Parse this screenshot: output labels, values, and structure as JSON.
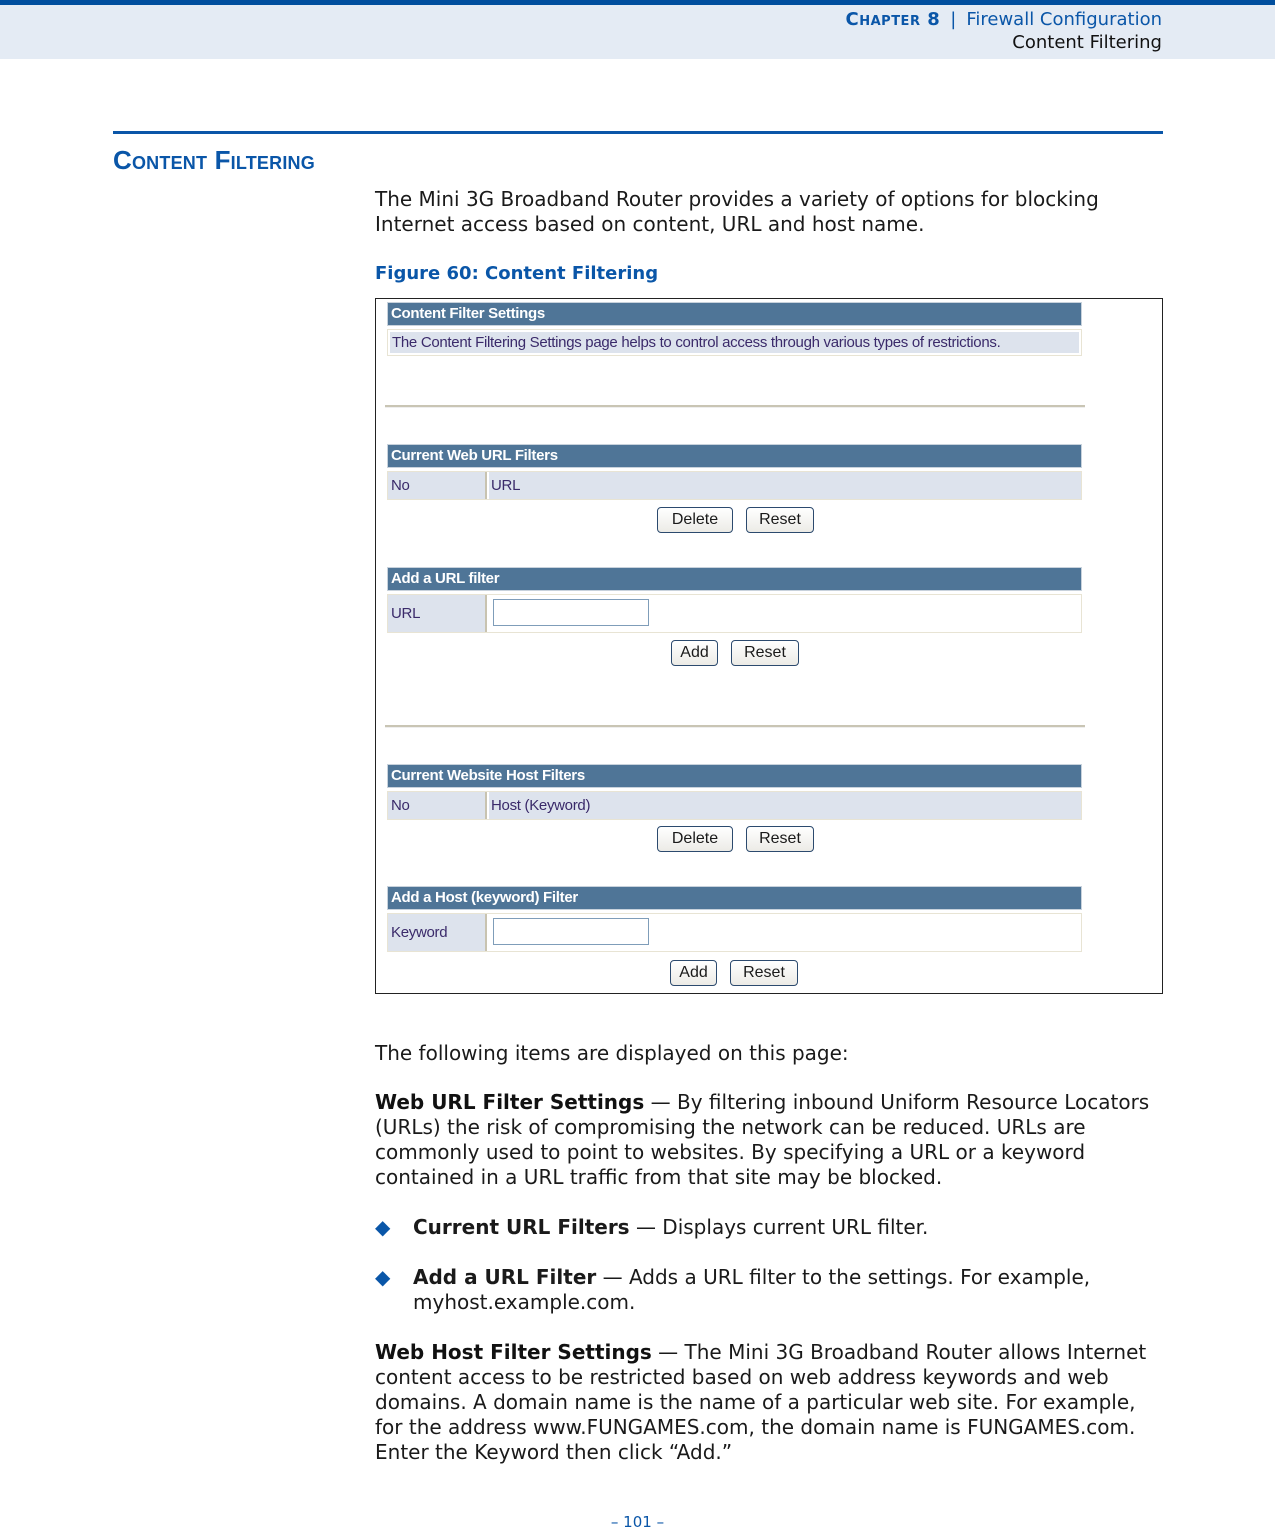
{
  "running_header": {
    "chapter_label": "Chapter 8",
    "separator": "|",
    "chapter_title": "Firewall Configuration",
    "section": "Content Filtering"
  },
  "section": {
    "title": "Content Filtering",
    "intro": "The Mini 3G Broadband Router provides a variety of options for blocking Internet access based on content, URL and host name."
  },
  "figure": {
    "caption": "Figure 60:  Content Filtering",
    "settings_panel": {
      "title": "Content Filter Settings",
      "description": "The Content Filtering Settings page helps to control access through various types of restrictions."
    },
    "current_url_filters": {
      "title": "Current Web URL Filters",
      "columns": [
        "No",
        "URL"
      ],
      "buttons": {
        "delete": "Delete",
        "reset": "Reset"
      }
    },
    "add_url_filter": {
      "title": "Add a URL filter",
      "field_label": "URL",
      "field_value": "",
      "buttons": {
        "add": "Add",
        "reset": "Reset"
      }
    },
    "current_host_filters": {
      "title": "Current Website Host Filters",
      "columns": [
        "No",
        "Host (Keyword)"
      ],
      "buttons": {
        "delete": "Delete",
        "reset": "Reset"
      }
    },
    "add_host_filter": {
      "title": "Add a Host (keyword) Filter",
      "field_label": "Keyword",
      "field_value": "",
      "buttons": {
        "add": "Add",
        "reset": "Reset"
      }
    }
  },
  "items_intro": "The following items are displayed on this page:",
  "web_url_filter": {
    "term": "Web URL Filter Settings",
    "text": " — By filtering inbound Uniform Resource Locators (URLs) the risk of compromising the network can be reduced. URLs are commonly used to point to websites. By specifying a URL or a keyword contained in a URL traffic from that site may be blocked."
  },
  "bullets": [
    {
      "term": "Current URL Filters",
      "text": " — Displays current URL filter."
    },
    {
      "term": "Add a URL Filter",
      "text": " — Adds a URL filter to the settings. For example, myhost.example.com."
    }
  ],
  "bullet_glyph": "◆",
  "web_host_filter": {
    "term": "Web Host Filter Settings",
    "text": " — The Mini 3G Broadband Router allows Internet content access to be restricted based on web address keywords and web domains. A domain name is the name of a particular web site. For example, for the address www.FUNGAMES.com, the domain name is FUNGAMES.com. Enter the Keyword then click “Add.”"
  },
  "page_number": "–  101  –",
  "colors": {
    "brand_blue": "#0a56a8",
    "panel_header": "#4f7597",
    "row_fill": "#dde3ed"
  }
}
